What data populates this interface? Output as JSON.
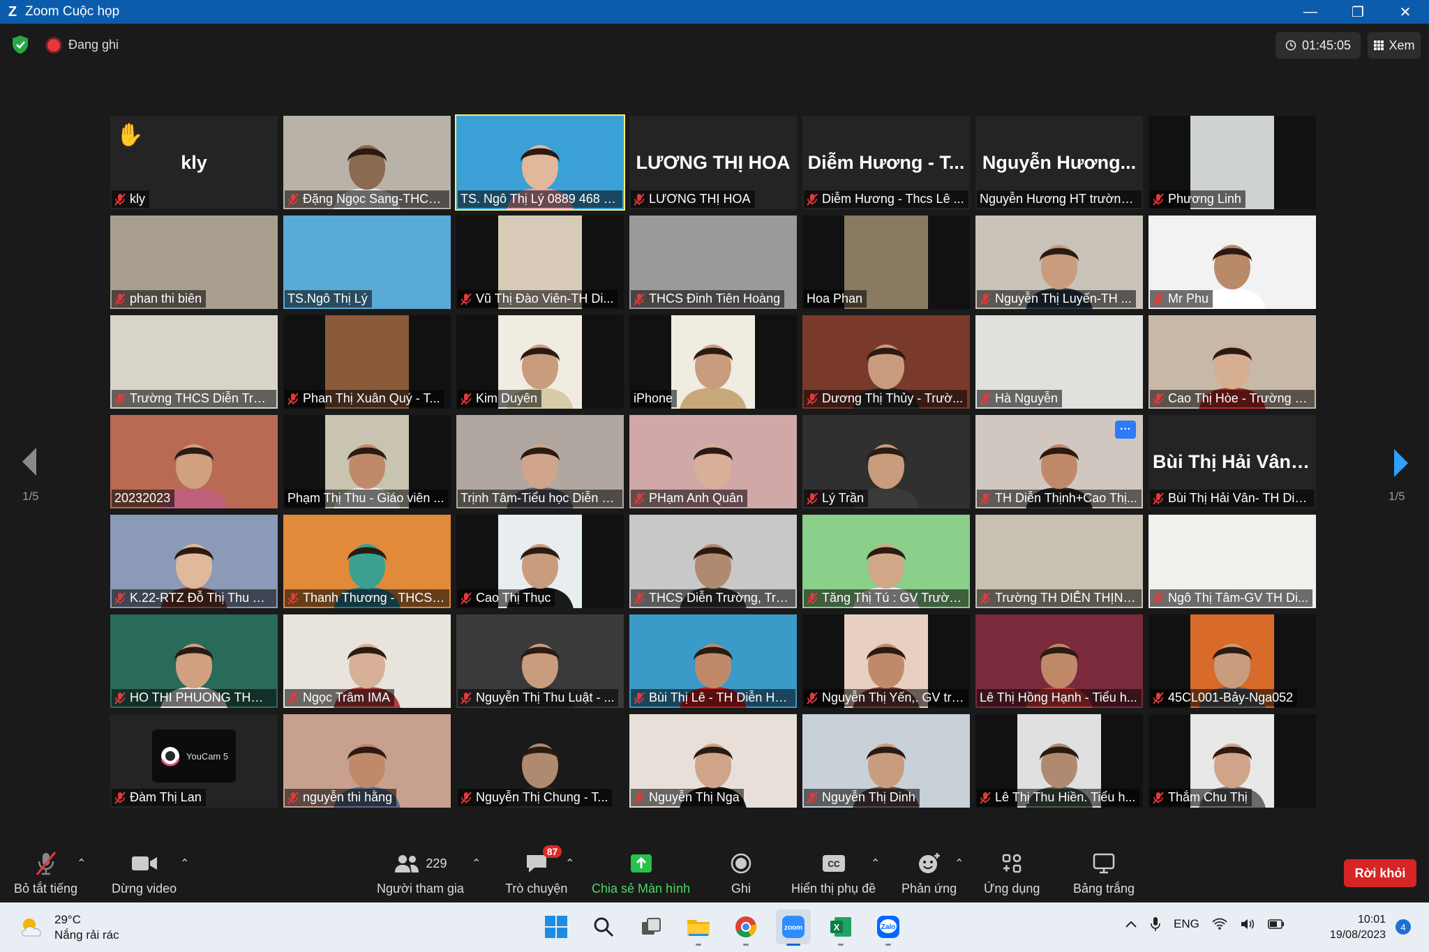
{
  "window": {
    "title": "Zoom Cuộc họp",
    "minimize": "—",
    "restore": "❐",
    "close": "✕"
  },
  "topbar": {
    "recording_label": "Đang ghi",
    "timer": "01:45:05",
    "view_label": "Xem"
  },
  "pager": {
    "left": "1/5",
    "right": "1/5"
  },
  "tiles": [
    {
      "name": "kly",
      "bigname": "kly",
      "muted": true,
      "hand": true,
      "bg": "#242424"
    },
    {
      "name": "Đặng Ngọc Sang-THCS...",
      "muted": true,
      "bg": "#b8b2a8",
      "skin": "#8a6a52",
      "shirt": "#e8e8e8"
    },
    {
      "name": "TS. Ngô Thị Lý 0889 468 968",
      "muted": false,
      "speaking": true,
      "bg": "#3aa0d6",
      "skin": "#e0b89a",
      "shirt": "#e8a0b0"
    },
    {
      "name": "LƯƠNG THỊ HOA",
      "bigname": "LƯƠNG THỊ HOA",
      "muted": true,
      "bg": "#242424"
    },
    {
      "name": "Diễm Hương - Thcs Lê ...",
      "bigname": "Diễm Hương - T...",
      "muted": true,
      "bg": "#242424"
    },
    {
      "name": "Nguyễn Hương HT trường ...",
      "bigname": "Nguyễn Hương...",
      "muted": false,
      "bg": "#242424"
    },
    {
      "name": "Phương Linh",
      "muted": true,
      "bg": "#cfd3cf",
      "narrow": true
    },
    {
      "name": "phan thi biên",
      "muted": true,
      "bg": "#a89e8e"
    },
    {
      "name": "TS.Ngô Thị Lý",
      "muted": false,
      "bg": "#5aaad8"
    },
    {
      "name": "Vũ Thị Đào Viên-TH Di...",
      "muted": true,
      "bg": "#d7cbb8",
      "narrow": true
    },
    {
      "name": "THCS Đinh Tiên Hoàng",
      "muted": true,
      "bg": "#9c9a98"
    },
    {
      "name": "Hoa Phan",
      "muted": false,
      "bg": "#8a7a62",
      "narrow": true
    },
    {
      "name": "Nguyễn Thị Luyến-TH ...",
      "muted": true,
      "bg": "#c8c2b8",
      "skin": "#c99c7e",
      "shirt": "#2e3a4a"
    },
    {
      "name": "Mr Phu",
      "muted": true,
      "bg": "#f2f2f2",
      "skin": "#b98a6a",
      "shirt": "#ffffff"
    },
    {
      "name": "Trường THCS Diễn Trườ...",
      "muted": true,
      "bg": "#d8d4c8"
    },
    {
      "name": "Phan Thị Xuân Quý - T...",
      "muted": true,
      "bg": "#8a5a3a",
      "narrow": true
    },
    {
      "name": "Kim Duyên",
      "muted": true,
      "bg": "#f0ece2",
      "narrow": true,
      "skin": "#c99c7e",
      "shirt": "#d8cca8"
    },
    {
      "name": "iPhone",
      "muted": false,
      "bg": "#f0ece2",
      "narrow": true,
      "skin": "#c99c7e",
      "shirt": "#c8a878"
    },
    {
      "name": "Dương Thị Thủy - Trườ...",
      "muted": true,
      "bg": "#7a3a2a",
      "skin": "#c99c7e",
      "shirt": "#2a2a2a"
    },
    {
      "name": "Hà Nguyễn",
      "muted": true,
      "bg": "#e0e0dc"
    },
    {
      "name": "Cao Thị Hòe - Trường ti...",
      "muted": true,
      "bg": "#c8b8a8",
      "skin": "#d6ae90",
      "shirt": "#c02828"
    },
    {
      "name": "20232023",
      "muted": false,
      "bg": "#b86a52",
      "skin": "#d0a080",
      "shirt": "#c0607a"
    },
    {
      "name": "Phạm Thị Thu - Giáo viên ...",
      "muted": false,
      "bg": "#c8c4b0",
      "narrow": true,
      "skin": "#c08a6a",
      "shirt": "#f0f0f0"
    },
    {
      "name": "Trịnh Tâm-Tiểu học Diễn Hải",
      "muted": false,
      "bg": "#b0a8a0",
      "skin": "#d0a488",
      "shirt": "#5a5a6a"
    },
    {
      "name": "PHạm Anh Quân",
      "muted": true,
      "bg": "#d0a8a8",
      "skin": "#d8b098",
      "shirt": "#d8a0a8"
    },
    {
      "name": "Lý Trần",
      "muted": true,
      "bg": "#303030",
      "skin": "#c99c7e",
      "shirt": "#3a3a3a"
    },
    {
      "name": "TH Diễn Thịnh+Cao Thị...",
      "muted": true,
      "more": true,
      "bg": "#d0c8c0",
      "skin": "#c08a6a",
      "shirt": "#2a2a2a"
    },
    {
      "name": "Bùi Thị Hải Vân- TH Diễ...",
      "bigname": "Bùi Thị Hải Vân-...",
      "muted": true,
      "bg": "#242424"
    },
    {
      "name": "K.22-RTZ Đỗ Thị Thu Tr...",
      "muted": true,
      "bg": "#8a9ab8",
      "skin": "#e0b89a",
      "shirt": "#6a3a2a"
    },
    {
      "name": "Thanh Thương - THCS ...",
      "muted": true,
      "bg": "#e08a3a",
      "skin": "#3aa090",
      "shirt": "#2a7a8a"
    },
    {
      "name": "Cao Thị Thục",
      "muted": true,
      "bg": "#e8eef0",
      "narrow": true,
      "skin": "#c99c7e",
      "shirt": "#1a1a1a"
    },
    {
      "name": "THCS Diễn Trường, Trần...",
      "muted": true,
      "bg": "#c8c8c8",
      "skin": "#b08a70",
      "shirt": "#3a3a3a"
    },
    {
      "name": "Tăng Thị Tú : GV Trườn...",
      "muted": true,
      "bg": "#8ad08a",
      "skin": "#d0a888",
      "shirt": "#f0f0f0"
    },
    {
      "name": "Trường TH DIỄN THỊNH...",
      "muted": true,
      "bg": "#c8c0b0"
    },
    {
      "name": "Ngô Thị Tâm-GV TH Di...",
      "muted": true,
      "bg": "#f0f0ec"
    },
    {
      "name": "HO THI PHUONG THCS ...",
      "muted": true,
      "bg": "#2a6a5a",
      "skin": "#d0a080",
      "shirt": "#f0f0f0"
    },
    {
      "name": "Ngọc Trâm IMA",
      "muted": true,
      "bg": "#e8e4dc",
      "skin": "#d8b098",
      "shirt": "#b04040"
    },
    {
      "name": "Nguyễn Thị Thu Luật - ...",
      "muted": true,
      "bg": "#3a3a3a",
      "skin": "#c99c7e",
      "shirt": "#2a2a2a"
    },
    {
      "name": "Bùi Thị Lê - TH Diễn Hả...",
      "muted": true,
      "bg": "#3a9ac8",
      "skin": "#c08a6a",
      "shirt": "#c02020"
    },
    {
      "name": "Nguyễn Thị Yến,. GV trư...",
      "muted": true,
      "bg": "#e8d0c0",
      "narrow": true,
      "skin": "#c08a6a",
      "shirt": "#6a3a3a"
    },
    {
      "name": "Lê Thị Hồng Hạnh - Tiểu h...",
      "muted": false,
      "bg": "#7a2a3a",
      "skin": "#c08a6a",
      "shirt": "#d04040"
    },
    {
      "name": "45CL001-Bảy-Nga052",
      "muted": true,
      "bg": "#d86a2a",
      "narrow": true,
      "skin": "#c99c7e",
      "shirt": "#5a5a5a"
    },
    {
      "name": "Đàm Thị Lan",
      "muted": true,
      "youcam": true,
      "bg": "#000000"
    },
    {
      "name": "nguyễn thi hằng",
      "muted": true,
      "bg": "#c8a090",
      "skin": "#c08a6a",
      "shirt": "#5a6a8a"
    },
    {
      "name": "Nguyễn Thị Chung - T...",
      "muted": true,
      "bg": "#1a1a1a",
      "skin": "#b08a70",
      "shirt": "#2a2a2a"
    },
    {
      "name": "Nguyễn Thị Nga",
      "muted": true,
      "bg": "#e8e0d8",
      "skin": "#d0a488",
      "shirt": "#1a1a1a"
    },
    {
      "name": "Nguyễn Thị Dinh",
      "muted": true,
      "bg": "#c8d0d8",
      "skin": "#c99c7e",
      "shirt": "#5a4a4a"
    },
    {
      "name": "Lê Thị Thu Hiền. Tiểu h...",
      "muted": true,
      "bg": "#e0e0e0",
      "narrow": true,
      "skin": "#b08a70",
      "shirt": "#4a5a4a"
    },
    {
      "name": "Thắm Chu Thị",
      "muted": true,
      "bg": "#e8e8e8",
      "narrow": true,
      "skin": "#d0a488",
      "shirt": "#6a6a6a"
    }
  ],
  "youcam_label": "YouCam 5",
  "toolbar": {
    "mute": "Bỏ tắt tiếng",
    "video": "Dừng video",
    "participants_count": "229",
    "participants": "Người tham gia",
    "chat": "Trò chuyện",
    "chat_badge": "87",
    "share": "Chia sẻ Màn hình",
    "record": "Ghi",
    "captions": "Hiển thị phụ đề",
    "reactions": "Phản ứng",
    "apps": "Ứng dụng",
    "whiteboard": "Bảng trắng",
    "leave": "Rời khỏi"
  },
  "taskbar": {
    "temp": "29°C",
    "weather": "Nắng rải rác",
    "lang": "ENG",
    "time": "10:01",
    "date": "19/08/2023",
    "notifications": "4"
  },
  "colors": {
    "titlebar": "#0b5cad",
    "speaking": "#f3f16a",
    "leave": "#d52525",
    "share": "#4cd964",
    "muted": "#e5383b"
  }
}
